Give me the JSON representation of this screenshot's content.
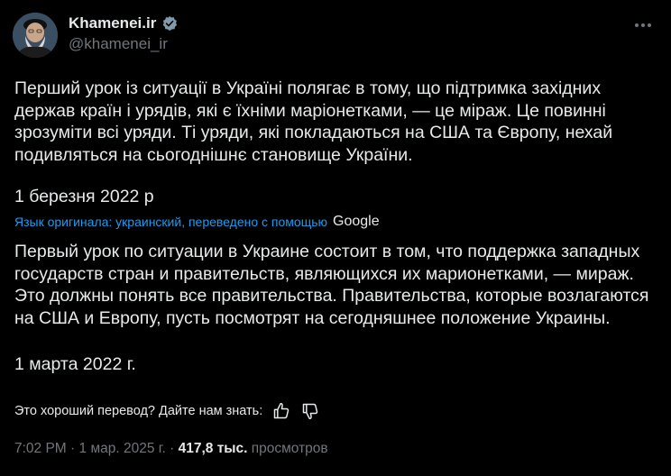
{
  "author": {
    "display_name": "Khamenei.ir",
    "handle": "@khamenei_ir",
    "avatar_icon": "profile-photo",
    "verified_icon": "verified-badge-icon"
  },
  "tweet": {
    "original_text": "Перший урок із ситуації в Україні полягає в тому, що підтримка західних держав країн і урядів, які є їхніми маріонетками, — це міраж. Це повинні зрозуміти всі уряди. Ті уряди, які покладаються на США та Європу, нехай подивляться на сьогоднішнє становище України.",
    "original_date": "1 березня 2022 р",
    "translation_note": "Язык оригинала: украинский, переведено с помощью",
    "translation_provider": "Google",
    "translated_text": "Первый урок по ситуации в Украине состоит в том, что поддержка западных государств стран и правительств, являющихся их марионетками, — мираж. Это должны понять все правительства. Правительства, которые возлагаются на США и Европу, пусть посмотрят на сегодняшнее положение Украины.",
    "translated_date": "1 марта 2022 г."
  },
  "feedback": {
    "prompt": "Это хороший перевод? Дайте нам знать:",
    "like_icon": "thumbs-up-icon",
    "dislike_icon": "thumbs-down-icon"
  },
  "meta": {
    "time": "7:02 PM",
    "sep1": " · ",
    "date": "1 мар. 2025 г.",
    "sep2": " · ",
    "views_count": "417,8 тыс.",
    "views_label": " просмотров"
  },
  "colors": {
    "background": "#000000",
    "text": "#e7e9ea",
    "muted": "#71767b",
    "accent": "#1d9bf0"
  }
}
